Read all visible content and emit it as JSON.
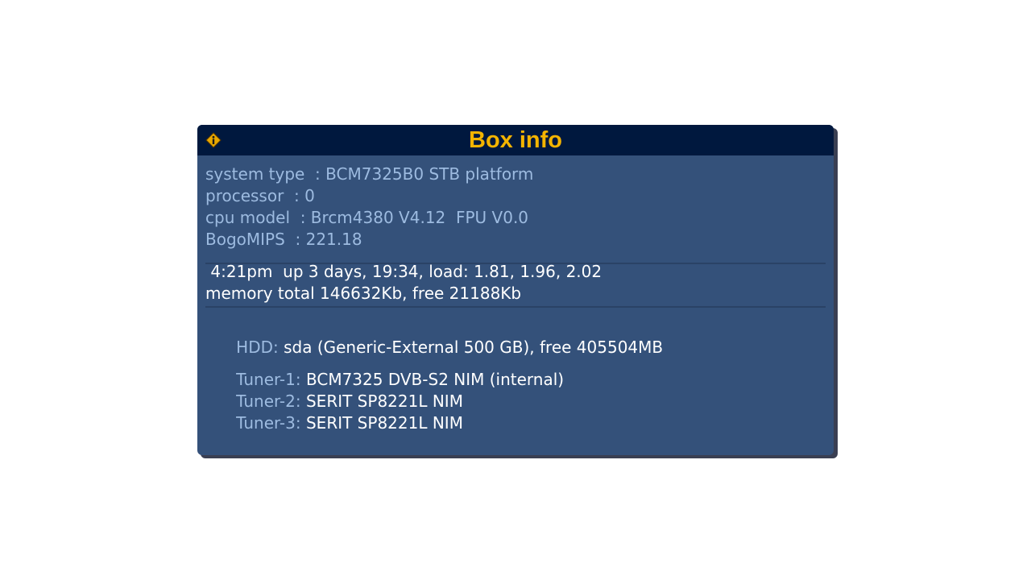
{
  "dialog": {
    "title": "Box info",
    "icon": "info-icon",
    "colors": {
      "title_bar": "#00183e",
      "panel": "#34517a",
      "title_text": "#f4b400",
      "label_text": "#9dbbe0",
      "value_text": "#ffffff"
    }
  },
  "cpu": {
    "system_type": "system type  : BCM7325B0 STB platform",
    "processor": "processor  : 0",
    "cpu_model": "cpu model  : Brcm4380 V4.12  FPU V0.0",
    "bogomips": "BogoMIPS  : 221.18"
  },
  "status": {
    "uptime": " 4:21pm  up 3 days, 19:34, load: 1.81, 1.96, 2.02",
    "memory": "memory total 146632Kb, free 21188Kb"
  },
  "hdd": {
    "label": "HDD:",
    "value": " sda (Generic-External 500 GB), free 405504MB"
  },
  "tuners": [
    {
      "label": "Tuner-1:",
      "value": " BCM7325 DVB-S2 NIM (internal)"
    },
    {
      "label": "Tuner-2:",
      "value": " SERIT SP8221L NIM"
    },
    {
      "label": "Tuner-3:",
      "value": " SERIT SP8221L NIM"
    }
  ]
}
